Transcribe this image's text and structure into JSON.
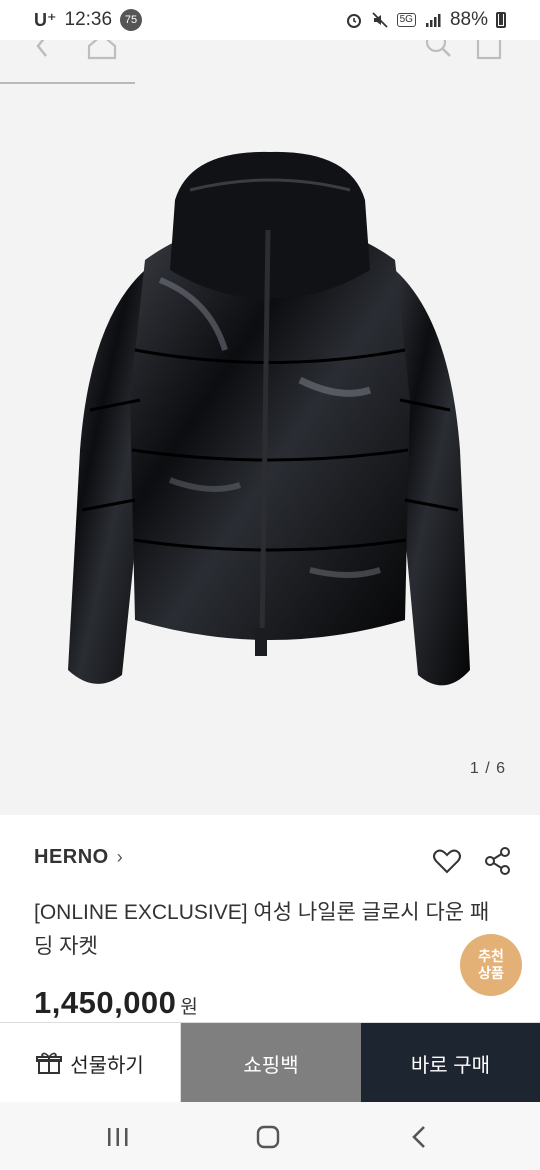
{
  "status_bar": {
    "carrier": "U⁺",
    "time": "12:36",
    "notification_count": "75",
    "network": "5G",
    "battery": "88%"
  },
  "gallery": {
    "counter": "1 / 6"
  },
  "product": {
    "brand": "HERNO",
    "brand_chevron": "›",
    "title": "[ONLINE EXCLUSIVE] 여성 나일론 글로시 다운 패딩 자켓",
    "price": "1,450,000",
    "currency": "원",
    "recommend_badge_line1": "추천",
    "recommend_badge_line2": "상품"
  },
  "actions": {
    "gift": "선물하기",
    "bag": "쇼핑백",
    "buy": "바로 구매"
  },
  "icons": {
    "back": "back-icon",
    "home": "home-icon",
    "search": "search-icon",
    "bag": "bag-icon",
    "heart": "heart-icon",
    "share": "share-icon",
    "gift": "gift-icon"
  },
  "colors": {
    "buy_button": "#1d2530",
    "bag_button": "#7f7f7f",
    "badge": "#e3b076"
  }
}
